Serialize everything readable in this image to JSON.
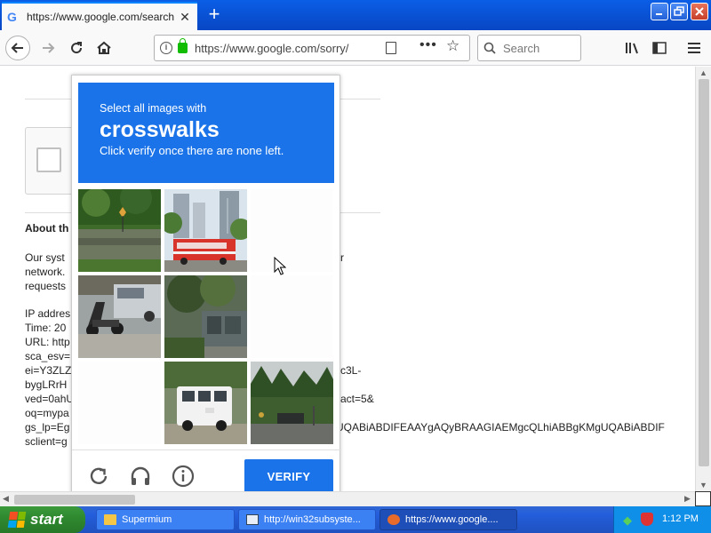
{
  "browser": {
    "tab_title": "https://www.google.com/search?q",
    "tab_favicon": "G",
    "tab_close": "✕",
    "new_tab": "+",
    "url": "https://www.google.com/sorry/",
    "search_placeholder": "Search"
  },
  "page": {
    "about_heading": "About th",
    "para_lines": [
      "Our syst",
      "network.",
      "requests"
    ],
    "para_right": "r",
    "info_lines": [
      "IP addres",
      "Time: 20",
      "URL: http",
      "sca_esv=",
      "ei=Y3ZLZ",
      "bygLRrH",
      "ved=0ahU",
      "oq=mypa",
      "gs_lp=Eg",
      "sclient=g"
    ],
    "info_right": {
      "line5": "c3L-",
      "line7": "act=5&",
      "line9": "UQABiABDIFEAAYgAQyBRAAGIAEMgcQLhiABBgKMgUQABiABDIF"
    }
  },
  "captcha": {
    "line1": "Select all images with",
    "keyword": "crosswalks",
    "line3": "Click verify once there are none left.",
    "verify_label": "VERIFY",
    "colors": {
      "accent": "#1a73e8"
    }
  },
  "taskbar": {
    "start_label": "start",
    "items": [
      "Supermium",
      "http://win32subsyste...",
      "https://www.google...."
    ],
    "clock": "1:12 PM"
  }
}
